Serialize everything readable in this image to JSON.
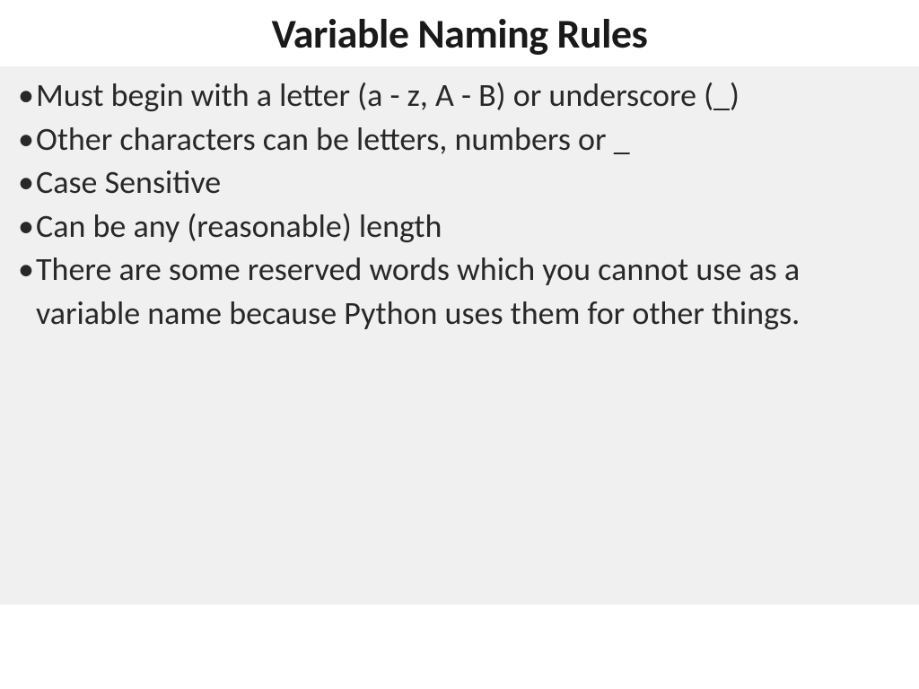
{
  "slide": {
    "title": "Variable Naming Rules",
    "bullets": [
      "Must begin with a letter (a - z, A - B) or underscore (_)",
      "Other characters can be letters, numbers or _",
      "Case Sensitive",
      "Can be any (reasonable) length",
      "There are some reserved words which you cannot use as a variable name because Python uses them for other things."
    ]
  }
}
